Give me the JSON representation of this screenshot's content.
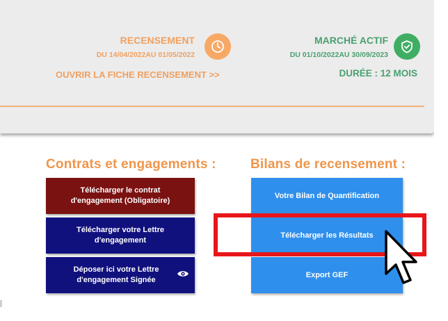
{
  "census": {
    "title": "RECENSEMENT",
    "dates": "DU 14/04/2022AU 01/05/2022",
    "link": "OUVRIR LA FICHE RECENSEMENT >>",
    "icon": "clock-icon",
    "color": "#f0a060"
  },
  "market": {
    "title": "MARCHÉ ACTIF",
    "dates": "DU 01/10/2022AU 30/09/2023",
    "duration": "DURÉE : 12 MOIS",
    "icon": "shield-check-icon",
    "color": "#4aa070"
  },
  "contracts": {
    "heading": "Contrats et engagements :",
    "buttons": [
      {
        "label": "Télécharger le contrat d'engagement (Obligatoire)",
        "color": "#7b1212"
      },
      {
        "label": "Télécharger votre Lettre d'engagement",
        "color": "#11117e"
      },
      {
        "label": "Déposer ici votre Lettre d'engagement Signée",
        "color": "#11117e",
        "icon": "eye-icon"
      }
    ]
  },
  "bilans": {
    "heading": "Bilans de recensement :",
    "buttons": [
      {
        "label": "Votre Bilan de Quantification",
        "color": "#2f8fec"
      },
      {
        "label": "Télécharger les Résultats",
        "color": "#2f8fec"
      },
      {
        "label": "Export GEF",
        "color": "#2f8fec"
      }
    ]
  },
  "annotation": {
    "highlight_color": "#e8161b",
    "cursor": "mouse-pointer-icon"
  }
}
